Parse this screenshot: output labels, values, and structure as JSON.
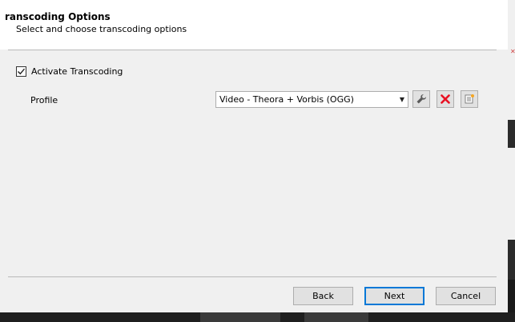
{
  "wizard": {
    "title": "ranscoding Options",
    "subtitle": "Select and choose transcoding options"
  },
  "transcoding": {
    "activate_label": "Activate Transcoding",
    "activate_checked": true,
    "profile_label": "Profile",
    "profile_selected": "Video - Theora + Vorbis (OGG)"
  },
  "icons": {
    "edit": "wrench-icon",
    "delete": "red-x-icon",
    "new": "new-profile-icon"
  },
  "footer": {
    "back_label": "Back",
    "next_label": "Next",
    "cancel_label": "Cancel"
  },
  "colors": {
    "delete_red": "#e81123",
    "focus_blue": "#0078d7"
  }
}
